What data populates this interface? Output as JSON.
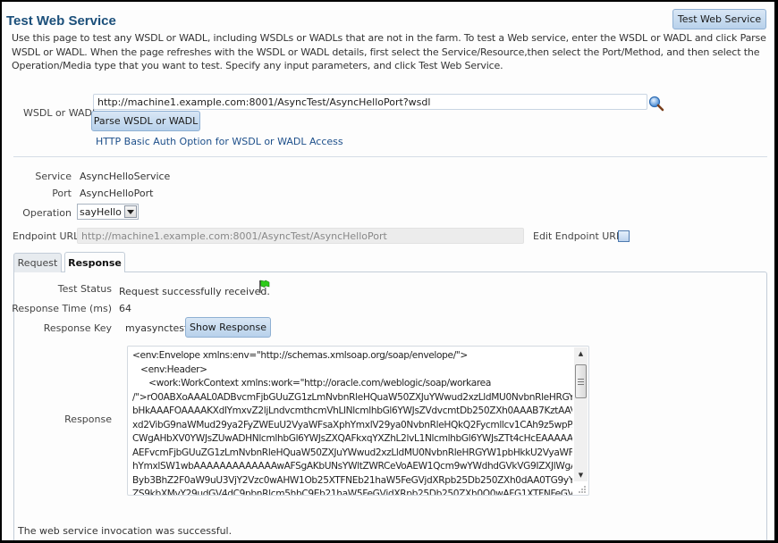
{
  "header": {
    "title": "Test Web Service",
    "test_button_label": "Test Web Service",
    "description": "Use this page to test any WSDL or WADL, including WSDLs or WADLs that are not in the farm. To test a Web service, enter the WSDL or WADL and click Parse WSDL or WADL. When the page refreshes with the WSDL or WADL details, first select the Service/Resource,then select the Port/Method, and then select the Operation/Media type that you want to test. Specify any input parameters, and click Test Web Service."
  },
  "wsdl": {
    "label": "WSDL or WADL",
    "value": "http://machine1.example.com:8001/AsyncTest/AsyncHelloPort?wsdl",
    "search_icon": "search-icon",
    "parse_button_label": "Parse WSDL or WADL",
    "auth_link": "HTTP Basic Auth Option for WSDL or WADL Access"
  },
  "details": {
    "service_label": "Service",
    "service_value": "AsyncHelloService",
    "port_label": "Port",
    "port_value": "AsyncHelloPort",
    "operation_label": "Operation",
    "operation_value": "sayHello",
    "endpoint_label": "Endpoint URL",
    "endpoint_value": "http://machine1.example.com:8001/AsyncTest/AsyncHelloPort",
    "edit_endpoint_label": "Edit Endpoint URL",
    "edit_endpoint_checked": false
  },
  "tabs": [
    {
      "label": "Request",
      "active": false
    },
    {
      "label": "Response",
      "active": true
    }
  ],
  "response": {
    "test_status_label": "Test Status",
    "test_status_value": "Request successfully received.",
    "status_icon": "green-flag-icon",
    "response_time_label": "Response Time (ms)",
    "response_time_value": "64",
    "response_key_label": "Response Key",
    "response_key_value": "myasynctest",
    "show_response_label": "Show Response",
    "response_label": "Response",
    "response_text": "<env:Envelope xmlns:env=\"http://schemas.xmlsoap.org/soap/envelope/\">\n   <env:Header>\n      <work:WorkContext xmlns:work=\"http://oracle.com/weblogic/soap/workarea\n/\">rO0ABXoAAAL0ADBvcmFjbGUuZG1zLmNvbnRleHQuaW50ZXJuYWwud2xzLldMU0NvbnRleHRGYW1p\nbHkAAAFOAAAAKXdlYmxvZ2ljLndvcmthcmVhLlNlcmlhbGl6YWJsZVdvcmtDb250ZXh0AAAB7KztAAVzcgA\nxd2VibG9naWMud29ya2FyZWEuU2VyaWFsaXphYmxlV29ya0NvbnRleHQkQ2Fycmllcv1CAh9z5wpPAwA\nCWgAHbXV0YWJsZUwADHNlcmlhbGl6YWJsZXQAFkxqYXZhL2lvL1NlcmlhbGl6YWJsZTt4cHcEAAAAAXNy\nAEFvcmFjbGUuZG1zLmNvbnRleHQuaW50ZXJuYWwud2xzLldMU0NvbnRleHRGYW1pbHkkU2VyaWFsaXp\nhYmxlSW1wbAAAAAAAAAAAAAwAFSgAKbUNsYWltZWRCeVoAEW1Qcm9wYWdhdGVkVG9IZXJlWgATbV\nByb3BhZ2F0aW9uU3VjY2Vzc0wAHW1Ob25XTFNEb21haW5FeGVjdXRpb25Db250ZXh0dAA0TG9yYWNs\nZS9kbXMvY29udGV4dC9pbnRlcm5hbC9Eb21haW5FeGVjdXRpb25Db250ZXh0O0wAFG1XTFNFeGVjdXR"
  },
  "footer": {
    "message": "The web service invocation was successful."
  }
}
